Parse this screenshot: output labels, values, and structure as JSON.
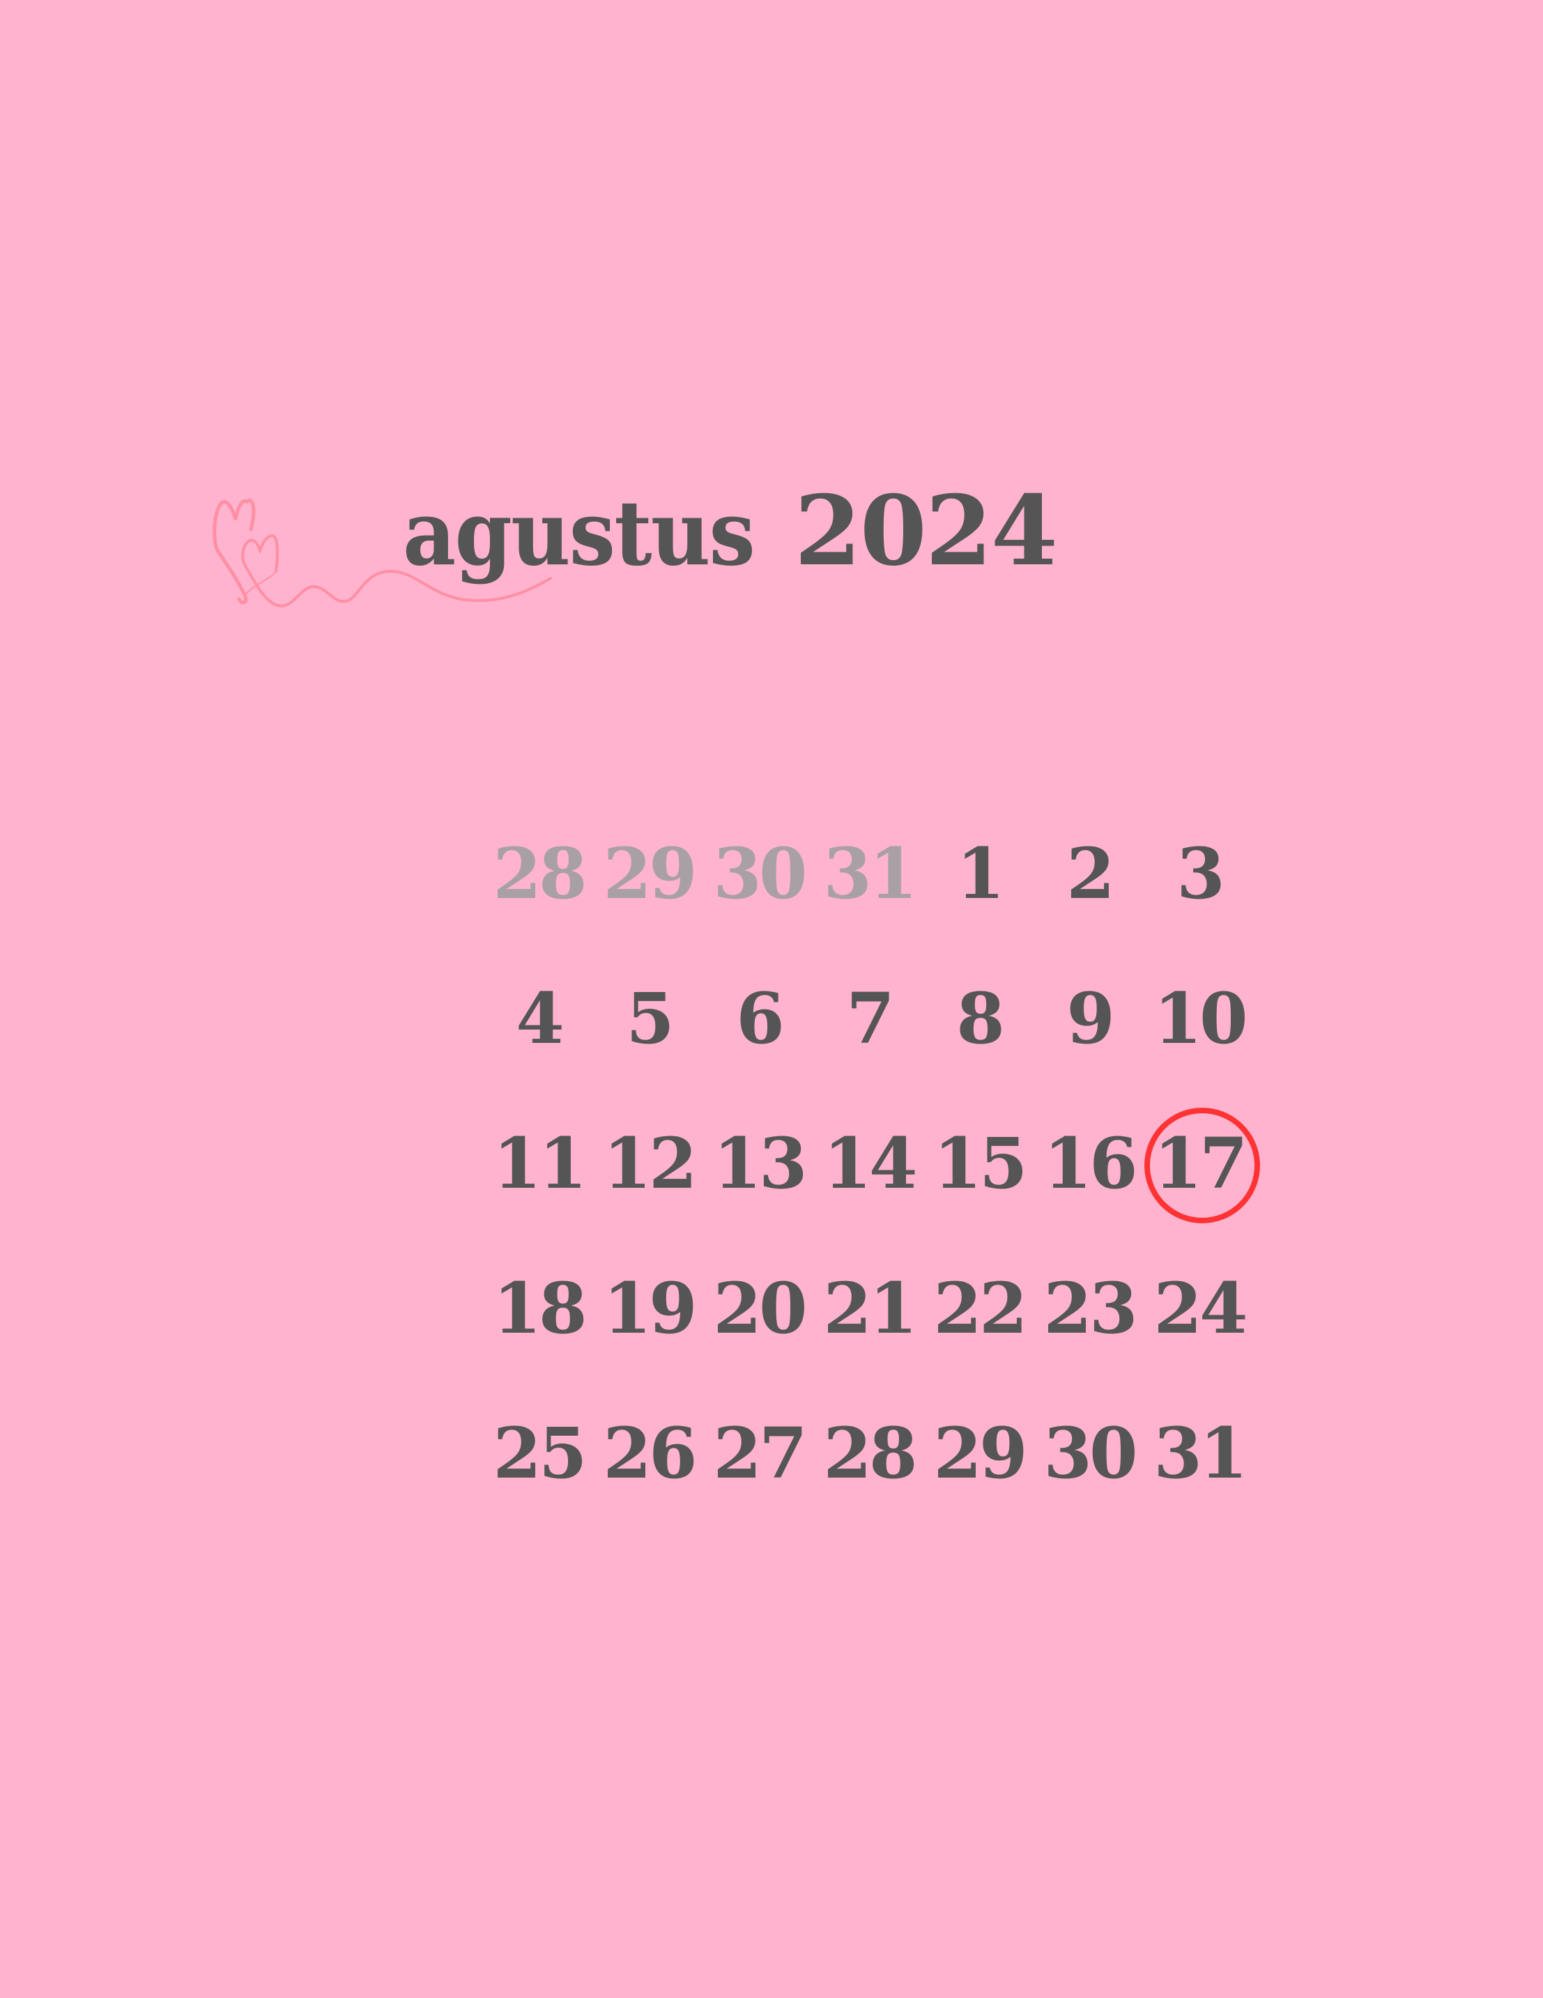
{
  "title": {
    "month": "agustus",
    "year": "2024"
  },
  "colors": {
    "background": "#ffb3cf",
    "text": "#555555",
    "muted": "#a8a0a4",
    "highlight": "#ff3333",
    "ornament": "#ff8fa3"
  },
  "days": [
    {
      "label": "28",
      "muted": true
    },
    {
      "label": "29",
      "muted": true
    },
    {
      "label": "30",
      "muted": true
    },
    {
      "label": "31",
      "muted": true
    },
    {
      "label": "1"
    },
    {
      "label": "2"
    },
    {
      "label": "3"
    },
    {
      "label": "4"
    },
    {
      "label": "5"
    },
    {
      "label": "6"
    },
    {
      "label": "7"
    },
    {
      "label": "8"
    },
    {
      "label": "9"
    },
    {
      "label": "10"
    },
    {
      "label": "11"
    },
    {
      "label": "12"
    },
    {
      "label": "13"
    },
    {
      "label": "14"
    },
    {
      "label": "15"
    },
    {
      "label": "16"
    },
    {
      "label": "17",
      "marked": true
    },
    {
      "label": "18"
    },
    {
      "label": "19"
    },
    {
      "label": "20"
    },
    {
      "label": "21"
    },
    {
      "label": "22"
    },
    {
      "label": "23"
    },
    {
      "label": "24"
    },
    {
      "label": "25"
    },
    {
      "label": "26"
    },
    {
      "label": "27"
    },
    {
      "label": "28"
    },
    {
      "label": "29"
    },
    {
      "label": "30"
    },
    {
      "label": "31"
    }
  ]
}
